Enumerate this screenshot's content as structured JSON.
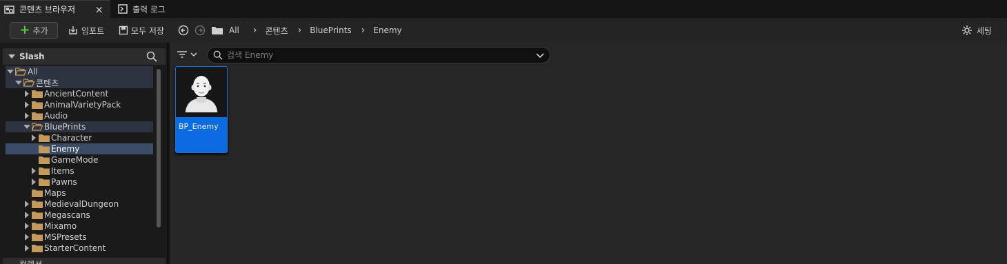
{
  "tabs": [
    {
      "label": "콘텐츠 브라우저",
      "icon": "content-browser-icon",
      "active": true
    },
    {
      "label": "출력 로그",
      "icon": "output-log-icon",
      "active": false
    }
  ],
  "toolbar": {
    "add_label": "추가",
    "import_label": "임포트",
    "save_all_label": "모두 저장",
    "settings_label": "세팅",
    "breadcrumb": [
      "All",
      "콘텐츠",
      "BluePrints",
      "Enemy"
    ]
  },
  "sidebar": {
    "title": "Slash",
    "bottom_label": "컬렉션",
    "tree": [
      {
        "label": "All",
        "depth": 0,
        "expanded": true,
        "state": "soft"
      },
      {
        "label": "콘텐츠",
        "depth": 1,
        "expanded": true,
        "state": "soft"
      },
      {
        "label": "AncientContent",
        "depth": 2,
        "expanded": false
      },
      {
        "label": "AnimalVarietyPack",
        "depth": 2,
        "expanded": false
      },
      {
        "label": "Audio",
        "depth": 2,
        "expanded": false
      },
      {
        "label": "BluePrints",
        "depth": 2,
        "expanded": true,
        "state": "soft"
      },
      {
        "label": "Character",
        "depth": 3,
        "expanded": false
      },
      {
        "label": "Enemy",
        "depth": 3,
        "leaf": true,
        "state": "selected"
      },
      {
        "label": "GameMode",
        "depth": 3,
        "leaf": true
      },
      {
        "label": "Items",
        "depth": 3,
        "expanded": false
      },
      {
        "label": "Pawns",
        "depth": 3,
        "expanded": false
      },
      {
        "label": "Maps",
        "depth": 2,
        "leaf": true
      },
      {
        "label": "MedievalDungeon",
        "depth": 2,
        "expanded": false
      },
      {
        "label": "Megascans",
        "depth": 2,
        "expanded": false
      },
      {
        "label": "Mixamo",
        "depth": 2,
        "expanded": false
      },
      {
        "label": "MSPresets",
        "depth": 2,
        "expanded": false
      },
      {
        "label": "StarterContent",
        "depth": 2,
        "expanded": false
      }
    ]
  },
  "main": {
    "search_placeholder": "검색 Enemy",
    "assets": [
      {
        "name": "BP_Enemy",
        "icon": "character-blueprint-icon"
      }
    ]
  },
  "colors": {
    "accent": "#0a6ce0",
    "add_plus": "#5ec442",
    "folder": "#c49a5a"
  }
}
